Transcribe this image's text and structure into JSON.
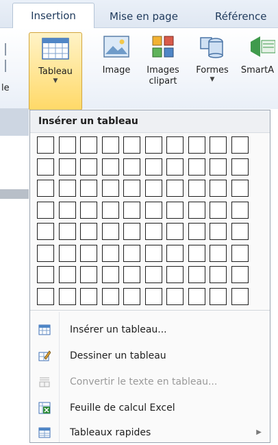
{
  "tabs": {
    "insertion": "Insertion",
    "mise_en_page": "Mise en page",
    "references": "Référence"
  },
  "ribbon": {
    "tableau": "Tableau",
    "image": "Image",
    "images_clipart_1": "Images",
    "images_clipart_2": "clipart",
    "formes": "Formes",
    "smartart": "SmartA",
    "left_stub": "le"
  },
  "menu": {
    "title": "Insérer un tableau",
    "grid": {
      "rows": 8,
      "cols": 10
    },
    "items": [
      {
        "label": "Insérer un tableau...",
        "icon": "insert-table-icon",
        "enabled": true
      },
      {
        "label": "Dessiner un tableau",
        "icon": "draw-table-icon",
        "enabled": true
      },
      {
        "label": "Convertir le texte en tableau...",
        "icon": "convert-text-icon",
        "enabled": false
      },
      {
        "label": "Feuille de calcul Excel",
        "icon": "excel-sheet-icon",
        "enabled": true
      },
      {
        "label": "Tableaux rapides",
        "icon": "quick-tables-icon",
        "enabled": true,
        "submenu": true
      }
    ]
  },
  "colors": {
    "accent": "#ffd968",
    "tab_text": "#1e395b",
    "excel_green": "#2e8b3a",
    "disabled": "#9a9a9a"
  }
}
